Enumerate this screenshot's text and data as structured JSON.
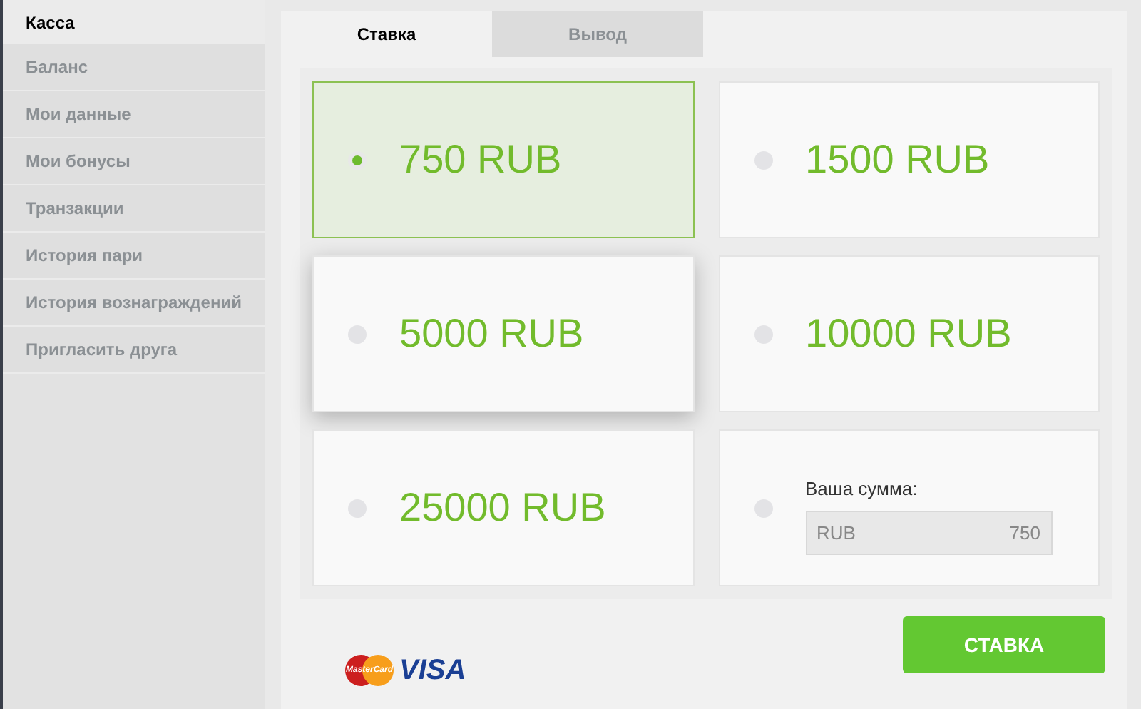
{
  "sidebar": {
    "items": [
      {
        "label": "Касса",
        "selected": true
      },
      {
        "label": "Баланс",
        "selected": false
      },
      {
        "label": "Мои данные",
        "selected": false
      },
      {
        "label": "Мои бонусы",
        "selected": false
      },
      {
        "label": "Транзакции",
        "selected": false
      },
      {
        "label": "История пари",
        "selected": false
      },
      {
        "label": "История вознаграждений",
        "selected": false
      },
      {
        "label": "Пригласить друга",
        "selected": false
      }
    ]
  },
  "tabs": [
    {
      "label": "Ставка",
      "selected": true
    },
    {
      "label": "Вывод",
      "selected": false
    }
  ],
  "options": [
    {
      "kind": "amount",
      "label": "750 RUB",
      "selected": true
    },
    {
      "kind": "amount",
      "label": "1500 RUB",
      "selected": false
    },
    {
      "kind": "amount",
      "label": "5000 RUB",
      "selected": false
    },
    {
      "kind": "amount",
      "label": "10000 RUB",
      "selected": false
    },
    {
      "kind": "amount",
      "label": "25000 RUB",
      "selected": false
    },
    {
      "kind": "custom",
      "label": "Ваша сумма:",
      "currency": "RUB",
      "value": "750",
      "selected": false
    }
  ],
  "payment_logos": {
    "mastercard": "MasterCard",
    "visa": "VISA"
  },
  "submit_button": "СТАВКА"
}
